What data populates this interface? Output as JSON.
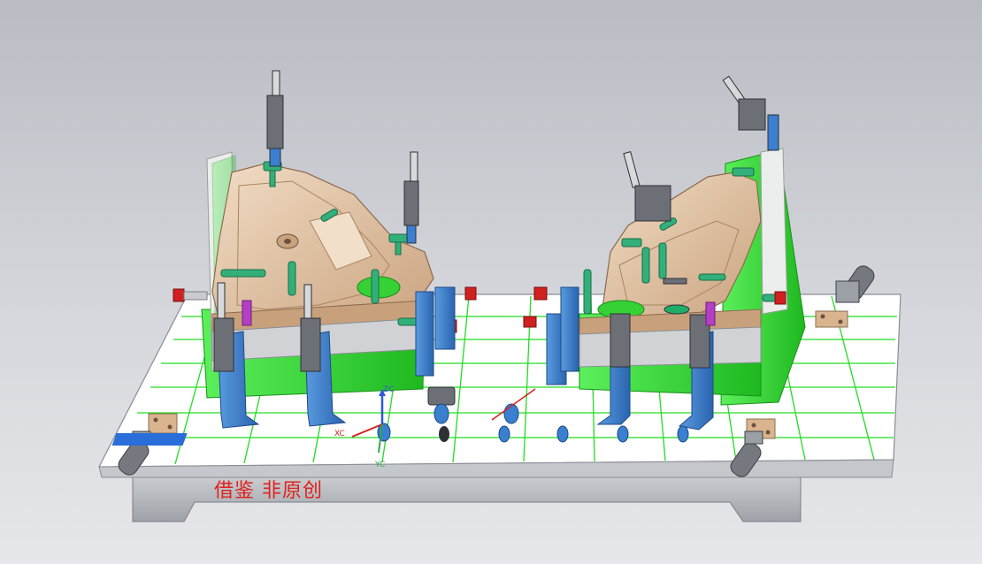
{
  "viewer": {
    "title": "",
    "background_top": "#b9bcc3",
    "background_bottom": "#e6e7ea"
  },
  "watermark": {
    "text": "借鉴 非原创",
    "color": "#e0211c"
  },
  "triad": {
    "zc_label": "ZC",
    "xc_label": "XC",
    "yc_label": "YC"
  },
  "colors": {
    "base_plate": "#ffffff",
    "grid_lines": "#22dd22",
    "support_green": "#2ee82e",
    "part_tan": "#e9c9a7",
    "fixture_blue": "#3a7fd0",
    "clamp_gray": "#6c7076",
    "pin_green": "#33b07a",
    "stop_red": "#d02020",
    "pad_tan": "#d9b48e"
  },
  "icons": [
    "coordinate-triad-icon",
    "locating-pin-icon",
    "toggle-clamp-icon"
  ]
}
